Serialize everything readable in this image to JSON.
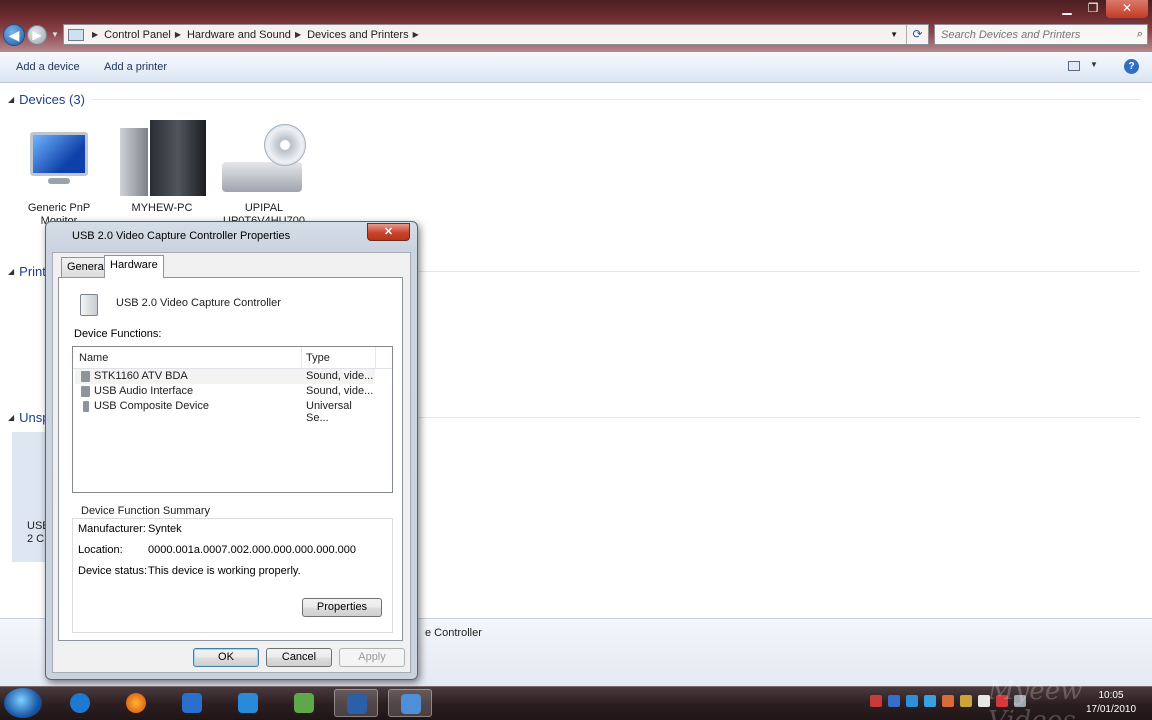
{
  "explorer": {
    "breadcrumbs": [
      "Control Panel",
      "Hardware and Sound",
      "Devices and Printers"
    ],
    "search_placeholder": "Search Devices and Printers",
    "commands": {
      "add_device": "Add a device",
      "add_printer": "Add a printer"
    },
    "help": "?",
    "groups": {
      "devices": "Devices (3)",
      "printers_partial": "Print",
      "unspecified_partial": "Unsp"
    },
    "devices": [
      {
        "label": "Generic PnP Monitor",
        "icon": "monitor-icon"
      },
      {
        "label": "MYHEW-PC",
        "icon": "computer-icon"
      },
      {
        "label": "UPIPAL UP0T6V4HU700",
        "icon": "optical-drive-icon"
      }
    ],
    "side_fragment": "USB 2 C",
    "bottom_text": "e Controller"
  },
  "dialog": {
    "title": "USB 2.0 Video Capture Controller Properties",
    "close": "✕",
    "tabs": [
      "General",
      "Hardware"
    ],
    "active_tab": "Hardware",
    "device_name": "USB 2.0 Video Capture Controller",
    "functions_label": "Device Functions:",
    "columns": {
      "name": "Name",
      "type": "Type"
    },
    "rows": [
      {
        "name": "STK1160 ATV BDA",
        "type": "Sound, vide...",
        "icon": "speaker-icon"
      },
      {
        "name": "USB Audio Interface",
        "type": "Sound, vide...",
        "icon": "speaker-icon"
      },
      {
        "name": "USB Composite Device",
        "type": "Universal Se...",
        "icon": "usb-plug-icon"
      }
    ],
    "summary": {
      "title": "Device Function Summary",
      "manufacturer_label": "Manufacturer:",
      "manufacturer": "Syntek",
      "location_label": "Location:",
      "location": "0000.001a.0007.002.000.000.000.000.000",
      "status_label": "Device status:",
      "status": "This device is working properly."
    },
    "buttons": {
      "properties": "Properties",
      "ok": "OK",
      "cancel": "Cancel",
      "apply": "Apply"
    }
  },
  "taskbar": {
    "apps": [
      "internet-explorer-icon",
      "firefox-icon",
      "app-icon",
      "app-icon",
      "app-icon",
      "film-icon",
      "control-panel-icon"
    ],
    "clock_time": "10:05",
    "clock_date": "17/01/2010"
  },
  "watermark": "Myeew Videos"
}
